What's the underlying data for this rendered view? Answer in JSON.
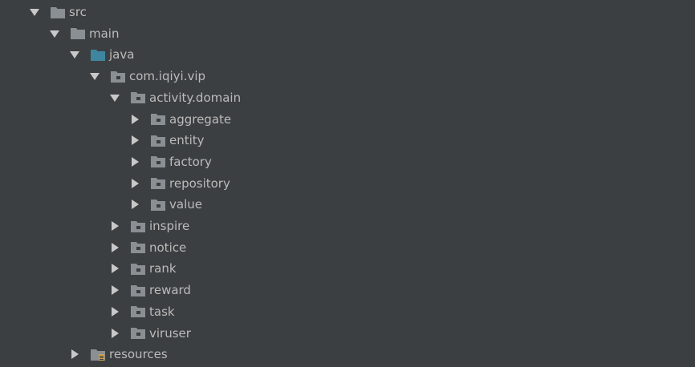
{
  "tree": {
    "items": [
      {
        "label": "src",
        "state": "expanded",
        "icon": "folder-icon",
        "depth": 0
      },
      {
        "label": "main",
        "state": "expanded",
        "icon": "folder-icon",
        "depth": 1
      },
      {
        "label": "java",
        "state": "expanded",
        "icon": "source-root-folder-icon",
        "depth": 2
      },
      {
        "label": "com.iqiyi.vip",
        "state": "expanded",
        "icon": "package-folder-icon",
        "depth": 3
      },
      {
        "label": "activity.domain",
        "state": "expanded",
        "icon": "package-folder-icon",
        "depth": 4
      },
      {
        "label": "aggregate",
        "state": "collapsed",
        "icon": "package-folder-icon",
        "depth": 5
      },
      {
        "label": "entity",
        "state": "collapsed",
        "icon": "package-folder-icon",
        "depth": 5
      },
      {
        "label": "factory",
        "state": "collapsed",
        "icon": "package-folder-icon",
        "depth": 5
      },
      {
        "label": "repository",
        "state": "collapsed",
        "icon": "package-folder-icon",
        "depth": 5
      },
      {
        "label": "value",
        "state": "collapsed",
        "icon": "package-folder-icon",
        "depth": 5
      },
      {
        "label": "inspire",
        "state": "collapsed",
        "icon": "package-folder-icon",
        "depth": 4
      },
      {
        "label": "notice",
        "state": "collapsed",
        "icon": "package-folder-icon",
        "depth": 4
      },
      {
        "label": "rank",
        "state": "collapsed",
        "icon": "package-folder-icon",
        "depth": 4
      },
      {
        "label": "reward",
        "state": "collapsed",
        "icon": "package-folder-icon",
        "depth": 4
      },
      {
        "label": "task",
        "state": "collapsed",
        "icon": "package-folder-icon",
        "depth": 4
      },
      {
        "label": "viruser",
        "state": "collapsed",
        "icon": "package-folder-icon",
        "depth": 4
      },
      {
        "label": "resources",
        "state": "collapsed",
        "icon": "resources-folder-icon",
        "depth": 2
      }
    ]
  },
  "colors": {
    "background": "#3c3f41",
    "text": "#bbbbbb",
    "folder": "#8a8f94",
    "source_root": "#3e86a0",
    "resources_badge": "#d7a13a"
  }
}
